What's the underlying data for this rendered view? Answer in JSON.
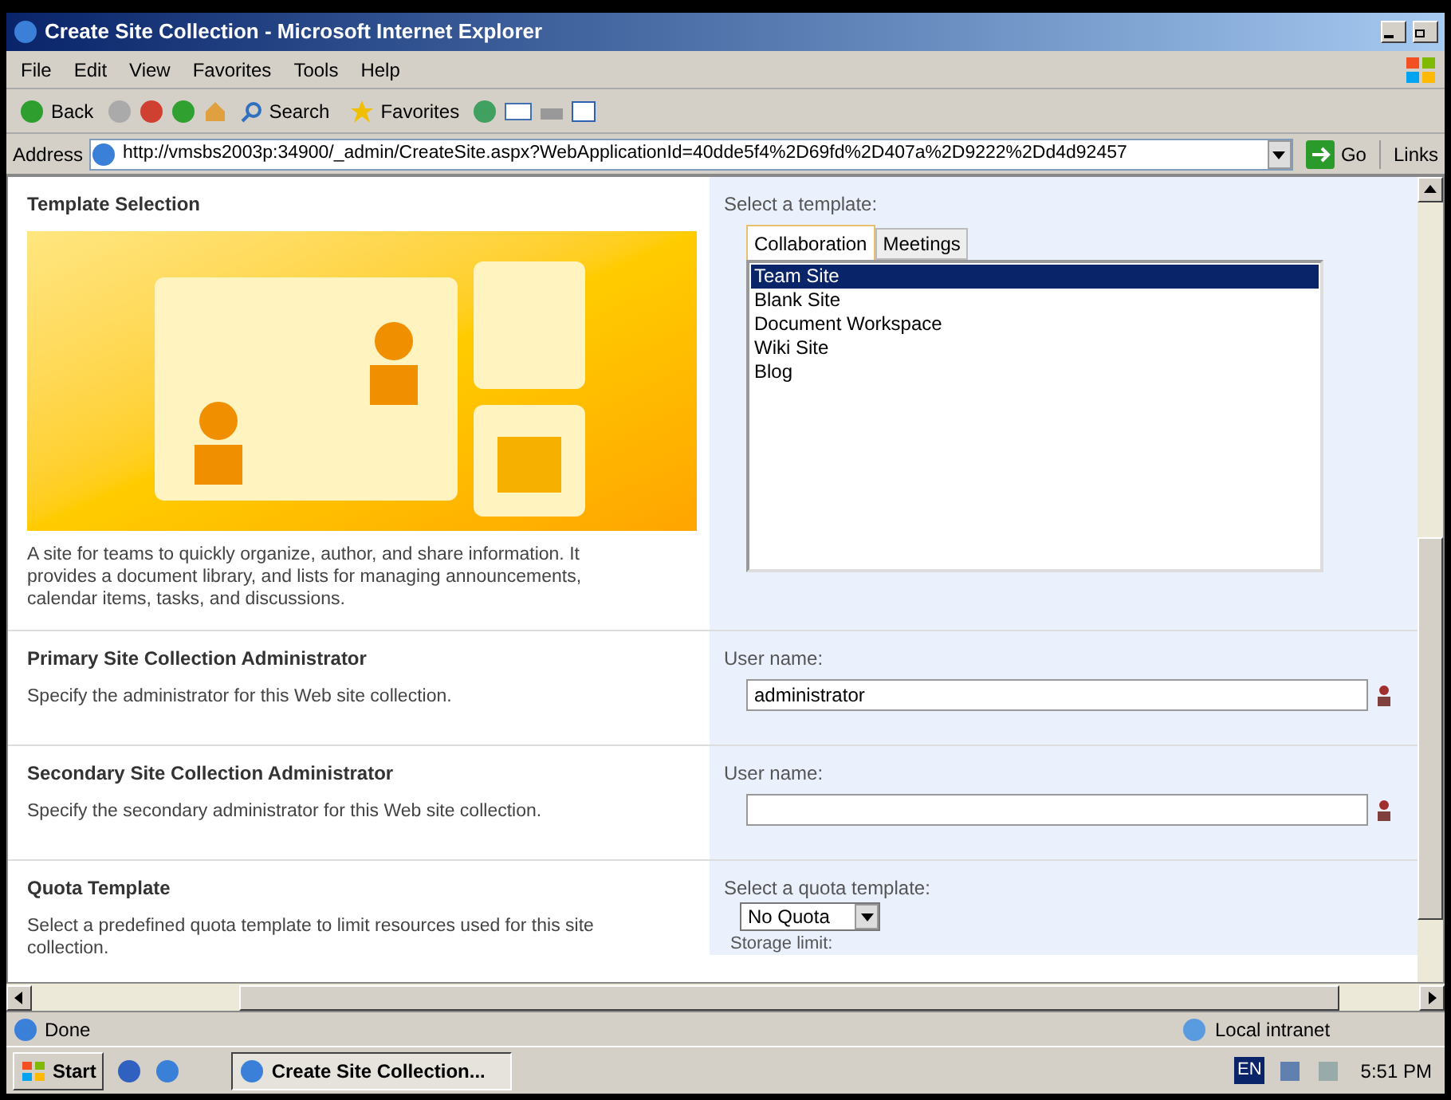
{
  "window": {
    "title": "Create Site Collection - Microsoft Internet Explorer"
  },
  "menu": [
    "File",
    "Edit",
    "View",
    "Favorites",
    "Tools",
    "Help"
  ],
  "toolbar": {
    "back": "Back",
    "search": "Search",
    "favorites": "Favorites"
  },
  "address": {
    "label": "Address",
    "url": "http://vmsbs2003p:34900/_admin/CreateSite.aspx?WebApplicationId=40dde5f4%2D69fd%2D407a%2D9222%2Dd4d92457",
    "go": "Go",
    "links": "Links"
  },
  "sections": [
    {
      "kind": "template",
      "title": "Template Selection",
      "description": "A site for teams to quickly organize, author, and share information. It provides a document library, and lists for managing announcements, calendar items, tasks, and discussions.",
      "label": "Select a template:",
      "tabs": [
        {
          "label": "Collaboration",
          "selected": true
        },
        {
          "label": "Meetings",
          "selected": false
        }
      ],
      "templates": [
        {
          "label": "Team Site",
          "selected": true
        },
        {
          "label": "Blank Site",
          "selected": false
        },
        {
          "label": "Document Workspace",
          "selected": false
        },
        {
          "label": "Wiki Site",
          "selected": false
        },
        {
          "label": "Blog",
          "selected": false
        }
      ]
    },
    {
      "kind": "user",
      "title": "Primary Site Collection Administrator",
      "description": "Specify the administrator for this Web site collection.",
      "label": "User name:",
      "value": "administrator"
    },
    {
      "kind": "user",
      "title": "Secondary Site Collection Administrator",
      "description": "Specify the secondary administrator for this Web site collection.",
      "label": "User name:"
    },
    {
      "kind": "quota",
      "title": "Quota Template",
      "description": "Select a predefined quota template to limit resources used for this site collection.",
      "label": "Select a quota template:",
      "value": "No Quota",
      "next_label": "Storage limit:"
    }
  ],
  "status_bar": {
    "text": "Done",
    "zone": "Local intranet"
  },
  "taskbar": {
    "start": "Start",
    "task": "Create Site Collection...",
    "language": "EN",
    "time": "5:51 PM"
  }
}
